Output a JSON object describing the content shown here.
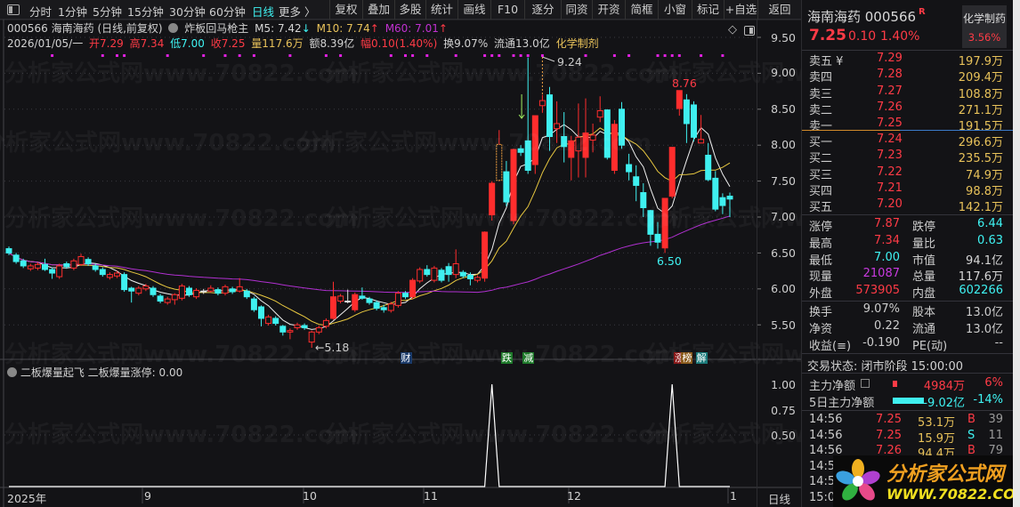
{
  "toolbar": {
    "periods": [
      "分时",
      "1分钟",
      "5分钟",
      "15分钟",
      "30分钟",
      "60分钟",
      "日线",
      "更多 〉"
    ],
    "active_period": "日线",
    "buttons": [
      "复权",
      "叠加",
      "多股",
      "统计",
      "画线",
      "F10",
      "逐分",
      "同资",
      "开资",
      "简框",
      "小窗",
      "标记",
      "+自选",
      "返回"
    ]
  },
  "info": {
    "title": "000566 海南海药 (日线,前复权)",
    "indicator": "炸板回马枪主",
    "m5": "M5: 7.42",
    "m5_arrow": "↓",
    "m10": "M10: 7.74",
    "m10_arrow": "↑",
    "m60": "M60: 7.01",
    "m60_arrow": "↑",
    "date": "2026/01/05/一",
    "open": "开7.29",
    "high": "高7.34",
    "low": "低7.00",
    "close": "收7.25",
    "volume": "量117.6万",
    "amount": "额8.39亿",
    "change": "幅0.10(1.40%)",
    "turnover": "换9.07%",
    "float": "流通13.0亿",
    "sector": "化学制剂"
  },
  "watermark": "分析家公式网www.70822.com",
  "annotations": {
    "high": "9.24",
    "local_high": "8.76",
    "local_low": "6.50",
    "low": "←5.18"
  },
  "price_axis": [
    "9.50",
    "9.00",
    "8.50",
    "8.00",
    "7.50",
    "7.00",
    "6.50",
    "6.00",
    "5.50"
  ],
  "indicator_panel": {
    "name": "二板爆量起飞",
    "value_label": "二板爆量涨停: 0.00",
    "axis": [
      "1.00",
      "0.75",
      "0.50"
    ]
  },
  "x_axis": {
    "labels": [
      "2025年",
      "9",
      "10",
      "11",
      "12",
      "1"
    ],
    "period": "日线"
  },
  "tags": [
    {
      "text": "财",
      "idx": 55,
      "bg": "#1a3a6a"
    },
    {
      "text": "跌",
      "idx": 69,
      "bg": "#1e7a2a"
    },
    {
      "text": "减",
      "idx": 72,
      "bg": "#1e7a2a"
    },
    {
      "text": "涨",
      "idx": 93,
      "bg": "#8a1a1a"
    },
    {
      "text": "榜",
      "idx": 94,
      "bg": "#8a5a1a"
    },
    {
      "text": "解",
      "idx": 96,
      "bg": "#1a7a7a"
    }
  ],
  "colors": {
    "up": "#ff2d2d",
    "down": "#3ff0f0",
    "ma5": "#f0f0f0",
    "ma10": "#e8c840",
    "ma60": "#b030d0",
    "dots": "#e020e0"
  },
  "chart_data": {
    "type": "candlestick",
    "ylim": [
      5.5,
      9.5
    ],
    "ma_periods": [
      5,
      10,
      60
    ],
    "candles": [
      [
        6.56,
        6.5
      ],
      [
        6.47,
        6.38
      ],
      [
        6.39,
        6.32
      ],
      [
        6.28,
        6.32
      ],
      [
        6.29,
        6.34
      ],
      [
        6.34,
        6.27,
        6.42,
        6.25
      ],
      [
        6.27,
        6.22,
        6.3,
        6.14
      ],
      [
        6.17,
        6.32
      ],
      [
        6.35,
        6.31
      ],
      [
        6.29,
        6.39
      ],
      [
        6.34,
        6.45,
        6.49,
        6.32
      ],
      [
        6.41,
        6.35
      ],
      [
        6.32,
        6.27
      ],
      [
        6.27,
        6.2
      ],
      [
        6.16,
        6.2
      ],
      [
        6.18,
        6.22
      ],
      [
        6.2,
        5.99
      ],
      [
        6.01,
        5.97,
        6.03,
        5.81
      ],
      [
        5.94,
        6.01
      ],
      [
        6.0,
        6.04
      ],
      [
        6.01,
        5.92
      ],
      [
        5.9,
        5.83
      ],
      [
        5.81,
        5.86
      ],
      [
        5.85,
        5.92,
        5.94,
        5.78
      ],
      [
        5.87,
        6.04
      ],
      [
        6.01,
        5.92
      ],
      [
        5.89,
        5.98
      ],
      [
        5.97,
        5.97,
        6.0,
        5.93
      ],
      [
        5.97,
        6.01,
        6.05,
        5.95
      ],
      [
        5.99,
        5.94
      ],
      [
        5.94,
        6.03
      ],
      [
        6.0,
        5.96
      ],
      [
        5.97,
        6.03,
        6.15,
        5.95
      ],
      [
        5.97,
        5.89
      ],
      [
        5.86,
        5.71
      ],
      [
        5.75,
        5.59,
        5.77,
        5.48
      ],
      [
        5.52,
        5.61
      ],
      [
        5.59,
        5.52
      ],
      [
        5.48,
        5.4,
        5.5,
        5.35
      ],
      [
        5.4,
        5.42,
        5.45,
        5.3
      ],
      [
        5.46,
        5.5
      ],
      [
        5.49,
        5.46
      ],
      [
        5.26,
        5.4,
        5.42,
        5.18
      ],
      [
        5.4,
        5.46
      ],
      [
        5.48,
        5.56
      ],
      [
        5.59,
        5.89,
        6.1,
        5.57
      ],
      [
        5.83,
        5.9
      ],
      [
        5.83,
        5.83,
        5.99,
        5.8
      ],
      [
        5.71,
        5.92
      ],
      [
        5.9,
        5.87,
        6.02,
        5.85
      ],
      [
        5.86,
        5.81
      ],
      [
        5.81,
        5.73
      ],
      [
        5.74,
        5.71,
        5.78,
        5.67
      ],
      [
        5.7,
        5.79
      ],
      [
        5.77,
        5.94
      ],
      [
        5.94,
        5.89
      ],
      [
        5.89,
        6.12
      ],
      [
        6.11,
        6.27
      ],
      [
        6.27,
        6.2,
        6.33,
        6.17
      ],
      [
        6.12,
        6.29
      ],
      [
        6.26,
        6.12
      ],
      [
        6.31,
        6.2,
        6.36,
        6.1
      ],
      [
        6.2,
        6.35,
        6.55,
        6.15
      ],
      [
        6.23,
        6.18
      ],
      [
        6.19,
        6.14,
        6.23,
        6.05
      ],
      [
        6.12,
        6.16
      ],
      [
        6.15,
        6.79,
        6.8,
        6.1
      ],
      [
        7.03,
        7.47,
        7.5,
        6.95
      ],
      [
        7.51,
        8.01,
        8.21,
        7.5
      ],
      [
        7.63,
        7.21,
        7.78,
        7.15
      ],
      [
        6.95,
        7.94,
        7.95,
        6.9
      ],
      [
        7.95,
        7.9,
        8.0,
        7.85
      ],
      [
        8.06,
        7.65,
        9.22,
        7.6
      ],
      [
        7.73,
        8.41,
        8.41,
        7.6
      ],
      [
        8.55,
        8.62,
        8.7,
        8.45
      ],
      [
        8.7,
        8.12,
        8.81,
        7.92
      ],
      [
        8.23,
        8.3,
        8.61,
        8.03
      ],
      [
        8.12,
        7.98,
        8.46,
        7.76
      ],
      [
        7.83,
        8.06,
        8.13,
        7.51
      ],
      [
        7.92,
        8.11,
        8.58,
        7.55
      ],
      [
        7.83,
        8.17,
        8.65,
        7.55
      ],
      [
        8.07,
        8.14,
        8.3,
        7.9
      ],
      [
        8.39,
        8.48,
        8.68,
        8.32
      ],
      [
        8.49,
        7.83,
        8.5,
        7.8
      ],
      [
        7.65,
        8.29,
        8.35,
        7.6
      ],
      [
        8.5,
        8.0,
        8.6,
        7.95
      ],
      [
        7.73,
        7.63,
        7.88,
        7.51
      ],
      [
        7.56,
        7.44,
        7.72,
        7.22
      ],
      [
        7.34,
        7.13,
        7.47,
        7.0
      ],
      [
        7.09,
        6.76,
        7.1,
        6.6
      ],
      [
        6.76,
        6.65,
        6.93,
        6.56
      ],
      [
        6.57,
        7.26,
        7.26,
        6.5
      ],
      [
        7.29,
        7.97,
        7.97,
        7.26
      ],
      [
        8.51,
        8.76,
        8.76,
        8.41
      ],
      [
        8.63,
        8.3,
        8.71,
        8.03
      ],
      [
        8.56,
        8.11,
        8.61,
        8.05
      ],
      [
        8.03,
        8.08,
        8.42,
        8.03
      ],
      [
        7.86,
        7.52,
        8.03,
        7.5
      ],
      [
        7.54,
        7.11,
        7.64,
        7.08
      ],
      [
        7.27,
        7.16,
        7.33,
        7.04
      ],
      [
        7.29,
        7.25,
        7.34,
        7.0
      ]
    ],
    "limit_up_idx": [
      68
    ],
    "signal_dots_idx": [
      6,
      13,
      15,
      16,
      22,
      27,
      30,
      32,
      34,
      39,
      44,
      46,
      53,
      55,
      56,
      58,
      62,
      66,
      67,
      68,
      70,
      71,
      72,
      74,
      80,
      84,
      86,
      90,
      91,
      92,
      93,
      96,
      99
    ],
    "indicator_hits_idx": [
      67,
      92
    ],
    "indicator_ylim": [
      0,
      1
    ]
  },
  "quote": {
    "name": "海南海药 000566",
    "badge": "R",
    "price": "7.25",
    "change": "0.10",
    "pct": "1.40%",
    "sector": "化学制药",
    "sector_pct": "3.56%"
  },
  "order_book": {
    "asks": [
      {
        "label": "卖五 ¥",
        "price": "7.29",
        "vol": "197.9万"
      },
      {
        "label": "卖四",
        "price": "7.28",
        "vol": "209.4万"
      },
      {
        "label": "卖三",
        "price": "7.27",
        "vol": "108.8万"
      },
      {
        "label": "卖二",
        "price": "7.26",
        "vol": "271.1万"
      },
      {
        "label": "卖一",
        "price": "7.25",
        "vol": "191.5万"
      }
    ],
    "bids": [
      {
        "label": "买一",
        "price": "7.24",
        "vol": "296.6万"
      },
      {
        "label": "买二",
        "price": "7.23",
        "vol": "235.5万"
      },
      {
        "label": "买三",
        "price": "7.22",
        "vol": "74.9万"
      },
      {
        "label": "买四",
        "price": "7.21",
        "vol": "98.8万"
      },
      {
        "label": "买五",
        "price": "7.20",
        "vol": "142.1万"
      }
    ]
  },
  "stats": [
    {
      "l1": "涨停",
      "v1": "7.87",
      "c1": "red",
      "l2": "跌停",
      "v2": "6.44",
      "c2": "cyan"
    },
    {
      "l1": "最高",
      "v1": "7.34",
      "c1": "red",
      "l2": "量比",
      "v2": "0.63",
      "c2": "cyan"
    },
    {
      "l1": "最低",
      "v1": "7.00",
      "c1": "cyan",
      "l2": "市值",
      "v2": "94.1亿",
      "c2": "wht"
    },
    {
      "l1": "现量",
      "v1": "21087",
      "c1": "pur",
      "l2": "总量",
      "v2": "117.6万",
      "c2": "wht"
    },
    {
      "l1": "外盘",
      "v1": "573905",
      "c1": "red",
      "l2": "内盘",
      "v2": "602266",
      "c2": "cyan"
    }
  ],
  "fundamentals": [
    {
      "l1": "换手",
      "v1": "9.07%",
      "l2": "股本",
      "v2": "13.0亿"
    },
    {
      "l1": "净资",
      "v1": "0.22",
      "l2": "流通",
      "v2": "13.0亿"
    },
    {
      "l1": "收益(≡)",
      "v1": "-0.190",
      "l2": "PE(动)",
      "v2": "--"
    }
  ],
  "trade_status": "交易状态: 闭市阶段 15:00:00",
  "capital_flow": [
    {
      "label": "主力净额",
      "amount": "4984万",
      "pct": "6%",
      "bar": 0.02,
      "c": "red"
    },
    {
      "label": "5日主力净额",
      "amount": "-9.02亿",
      "pct": "-14%",
      "bar": 0.14,
      "c": "cyan"
    }
  ],
  "ticks": [
    {
      "time": "14:56",
      "price": "7.25",
      "vol": "53.1万",
      "side": "B",
      "count": "39"
    },
    {
      "time": "14:56",
      "price": "7.25",
      "vol": "15.9万",
      "side": "S",
      "count": "11"
    },
    {
      "time": "14:56",
      "price": "7.26",
      "vol": "94.4万",
      "side": "B",
      "count": "79"
    },
    {
      "time": "14:5"
    },
    {
      "time": "14:5"
    },
    {
      "time": "15:0"
    }
  ],
  "logo": {
    "name": "分析家公式网",
    "url": "WWW.70822.COM"
  }
}
